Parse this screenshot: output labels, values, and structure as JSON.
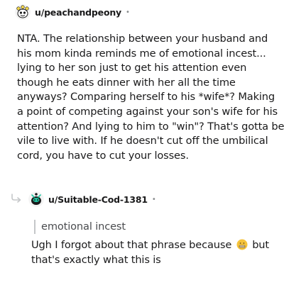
{
  "comment": {
    "username": "u/peachandpeony",
    "separator": "•",
    "lines": [
      "NTA. The relationship between your husband and",
      "his mom kinda reminds me of emotional incest...",
      "lying to her son just to get his attention even",
      "though he eats dinner with her all the time",
      "anyways? Comparing herself to his *wife*? Making",
      "a point of competing against your son's wife for his",
      "attention? And lying to him to \"win\"? That's gotta be",
      "vile to live with. If he doesn't cut off the umbilical",
      "cord, you have to cut your losses."
    ]
  },
  "reply": {
    "username": "u/Suitable-Cod-1381",
    "separator": "•",
    "quote": "emotional incest",
    "line1_before": "Ugh I forgot about that phrase because",
    "line1_after": "but",
    "line2": "that's exactly what this is",
    "emoji": "grimacing-face-emoji"
  },
  "colors": {
    "text": "#1a1a1b",
    "meta": "#878a8c",
    "quote_bar": "#c5c7c9",
    "emoji_yellow": "#f5c33b"
  }
}
